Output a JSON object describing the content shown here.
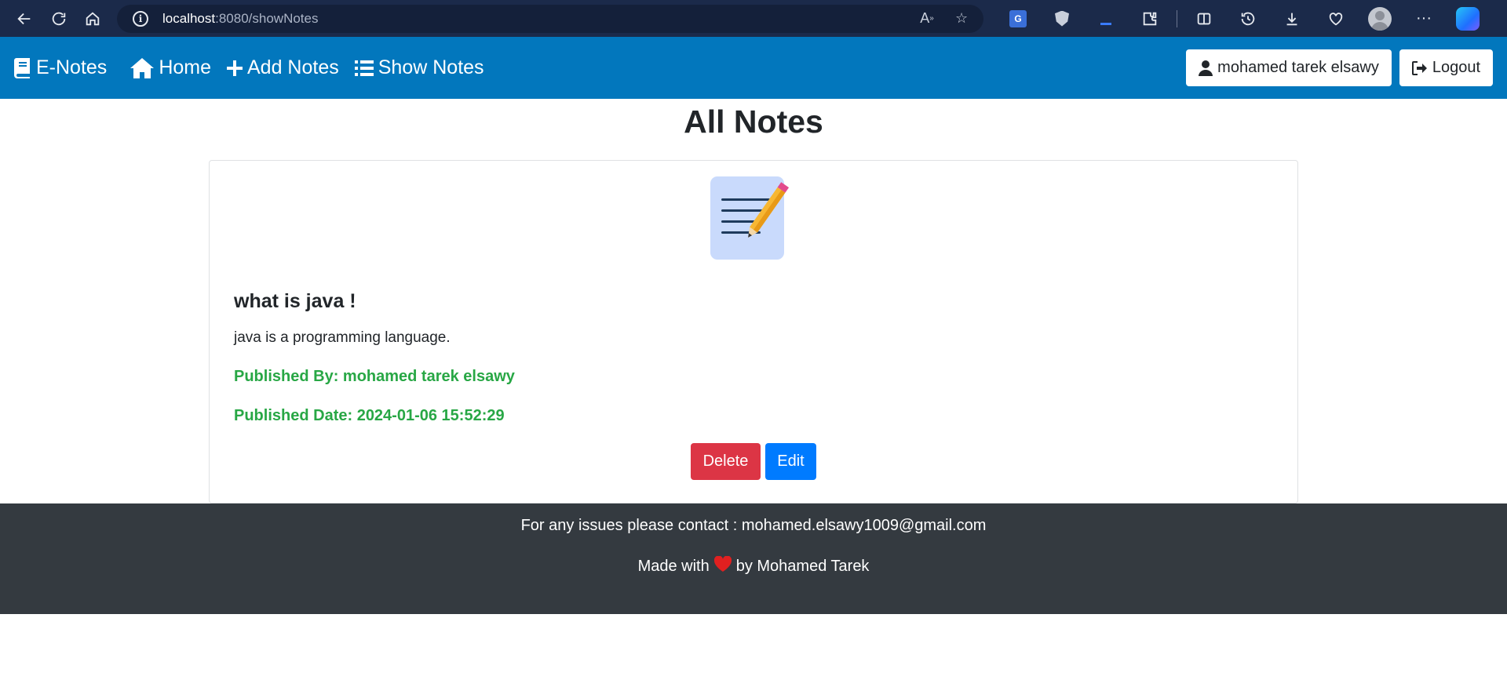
{
  "browser": {
    "url_host": "localhost",
    "url_path": ":8080/showNotes"
  },
  "navbar": {
    "brand": "E-Notes",
    "links": [
      "Home",
      "Add Notes",
      "Show Notes"
    ],
    "user": "mohamed tarek elsawy",
    "logout": "Logout",
    "color": "#0277bd"
  },
  "main": {
    "title": "All Notes",
    "note": {
      "title": "what is java !",
      "body": "java is a programming language.",
      "published_by": "Published By: mohamed tarek elsawy",
      "published_date": "Published Date: 2024-01-06 15:52:29",
      "delete_label": "Delete",
      "edit_label": "Edit"
    }
  },
  "footer": {
    "contact": "For any issues please contact : mohamed.elsawy1009@gmail.com",
    "made_prefix": "Made with",
    "made_suffix": "by Mohamed Tarek"
  },
  "colors": {
    "danger": "#dc3545",
    "primary": "#007bff",
    "success": "#28a745",
    "footer": "#343a40"
  }
}
